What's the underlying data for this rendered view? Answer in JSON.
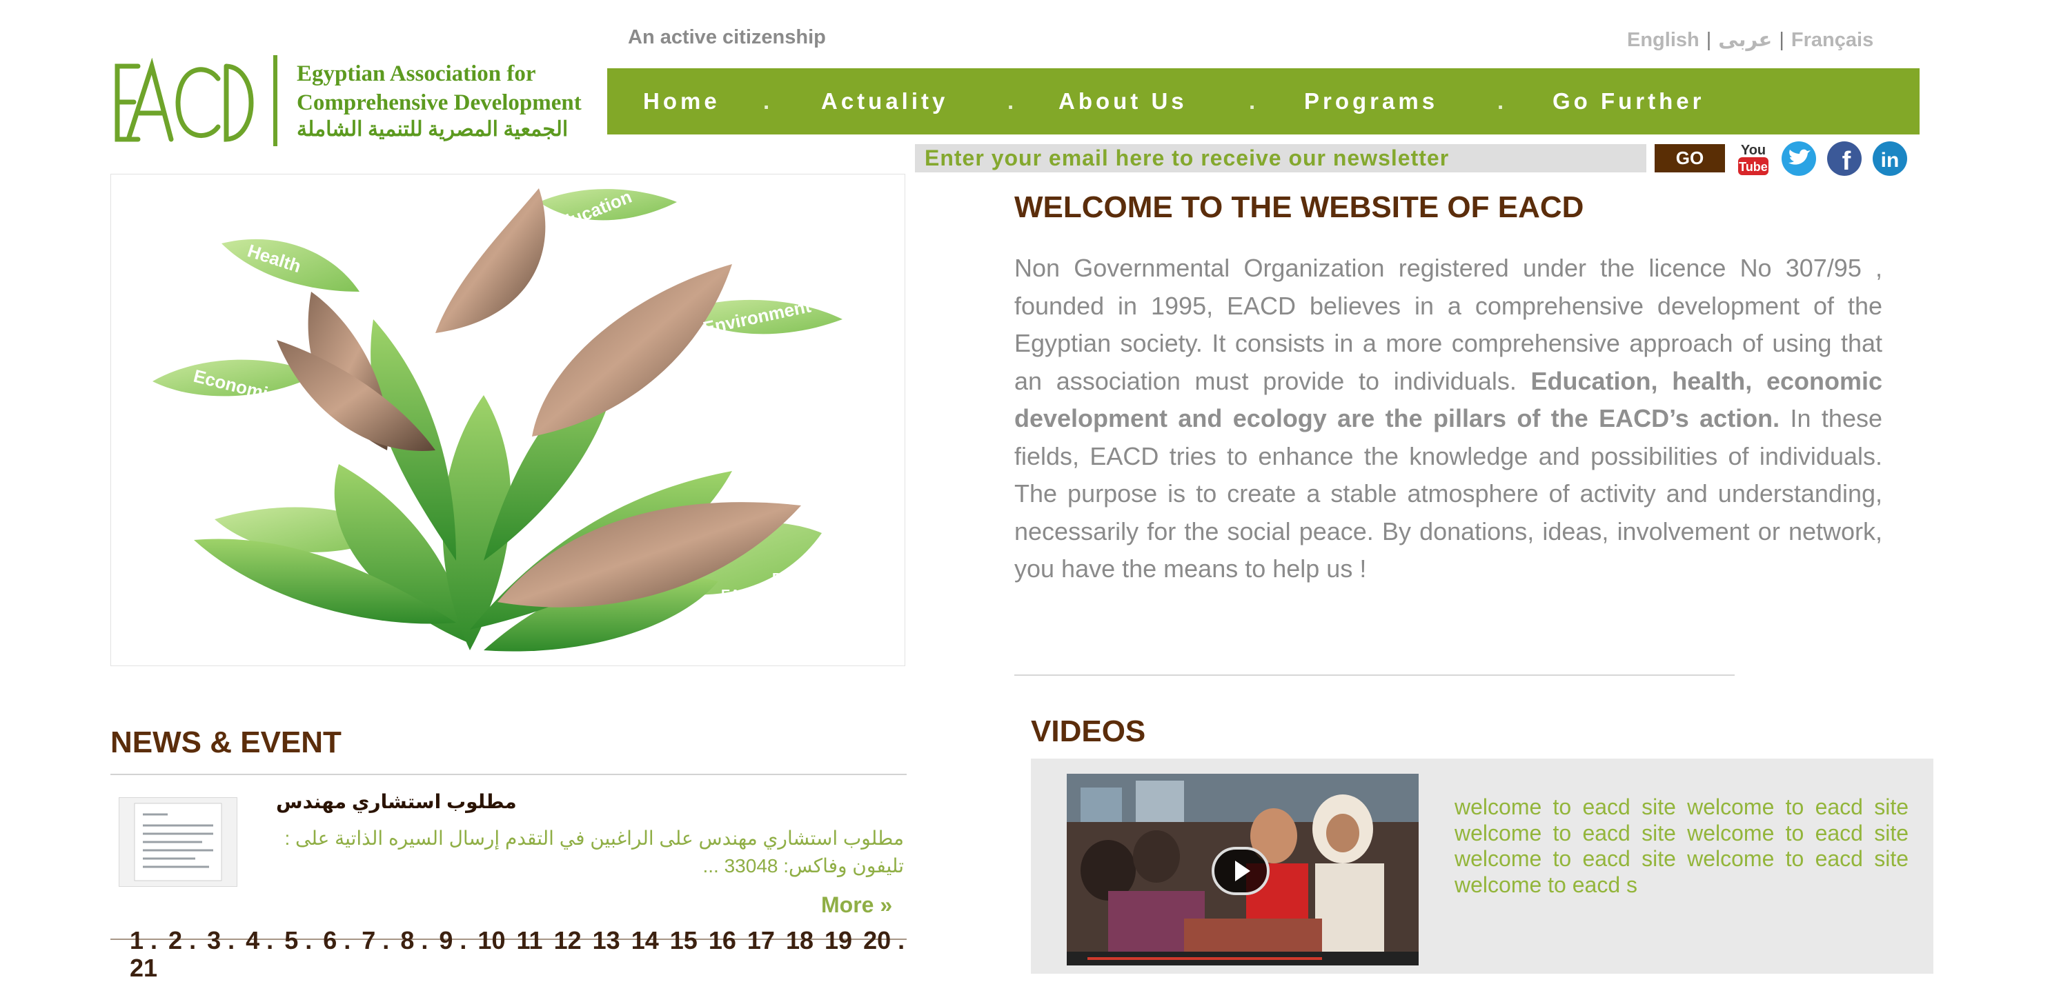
{
  "header": {
    "tagline": "An active citizenship",
    "languages": [
      "English",
      "عربى",
      "Français"
    ],
    "logo": {
      "mark": "EACD",
      "name_en_line1": "Egyptian Association for",
      "name_en_line2": "Comprehensive Development",
      "name_ar": "الجمعية المصرية للتنمية الشاملة",
      "color": "#6ea42a"
    }
  },
  "nav": {
    "items": [
      "Home",
      "Actuality",
      "About Us",
      "Programs",
      "Go Further"
    ],
    "separator": ".",
    "background": "#82a828"
  },
  "newsletter": {
    "placeholder": "Enter your email here to receive our newsletter",
    "button_label": "GO"
  },
  "social": {
    "youtube_label_top": "You",
    "youtube_label_bottom": "Tube",
    "twitter_glyph": "t",
    "facebook_glyph": "f",
    "linkedin_glyph": "in"
  },
  "hero": {
    "labels": [
      "Health",
      "Education",
      "Environment",
      "Economic",
      "Part of",
      "EACD Family"
    ]
  },
  "welcome": {
    "title": "WELCOME TO THE WEBSITE OF EACD",
    "text_intro": "Non Governmental Organization  registered  under the licence No 307/95 , founded in 1995, EACD believes in a comprehensive development of the Egyptian society. It consists in a more comprehensive approach of using that an association must provide to individuals. ",
    "text_bold": "Education, health, economic development and ecology are the pillars of the EACD’s action.",
    "text_rest": " In these fields, EACD tries to enhance the knowledge and possibilities of individuals. The purpose is to create a stable atmosphere of activity and understanding, necessarily for the social peace. By donations, ideas, involvement or network, you have the means to help us !"
  },
  "news": {
    "title": "NEWS & EVENT",
    "item_title": "مطلوب استشاري مهندس",
    "item_excerpt": "مطلوب استشاري مهندس   على الراغبين في التقدم إرسال السيره الذاتية على : تليفون وفاكس: 33048 ...",
    "more_label": "More »",
    "pages": [
      "1 .",
      "2 .",
      "3 .",
      "4 .",
      "5 .",
      "6 .",
      "7 .",
      "8 .",
      "9 .",
      "10",
      "11",
      "12",
      "13",
      "14",
      "15",
      "16",
      "17",
      "18",
      "19",
      "20 .",
      "21"
    ]
  },
  "videos": {
    "title": "VIDEOS",
    "caption": "welcome to eacd site welcome to eacd site welcome to eacd site welcome to eacd site welcome to eacd site welcome to eacd site welcome to eacd s"
  }
}
